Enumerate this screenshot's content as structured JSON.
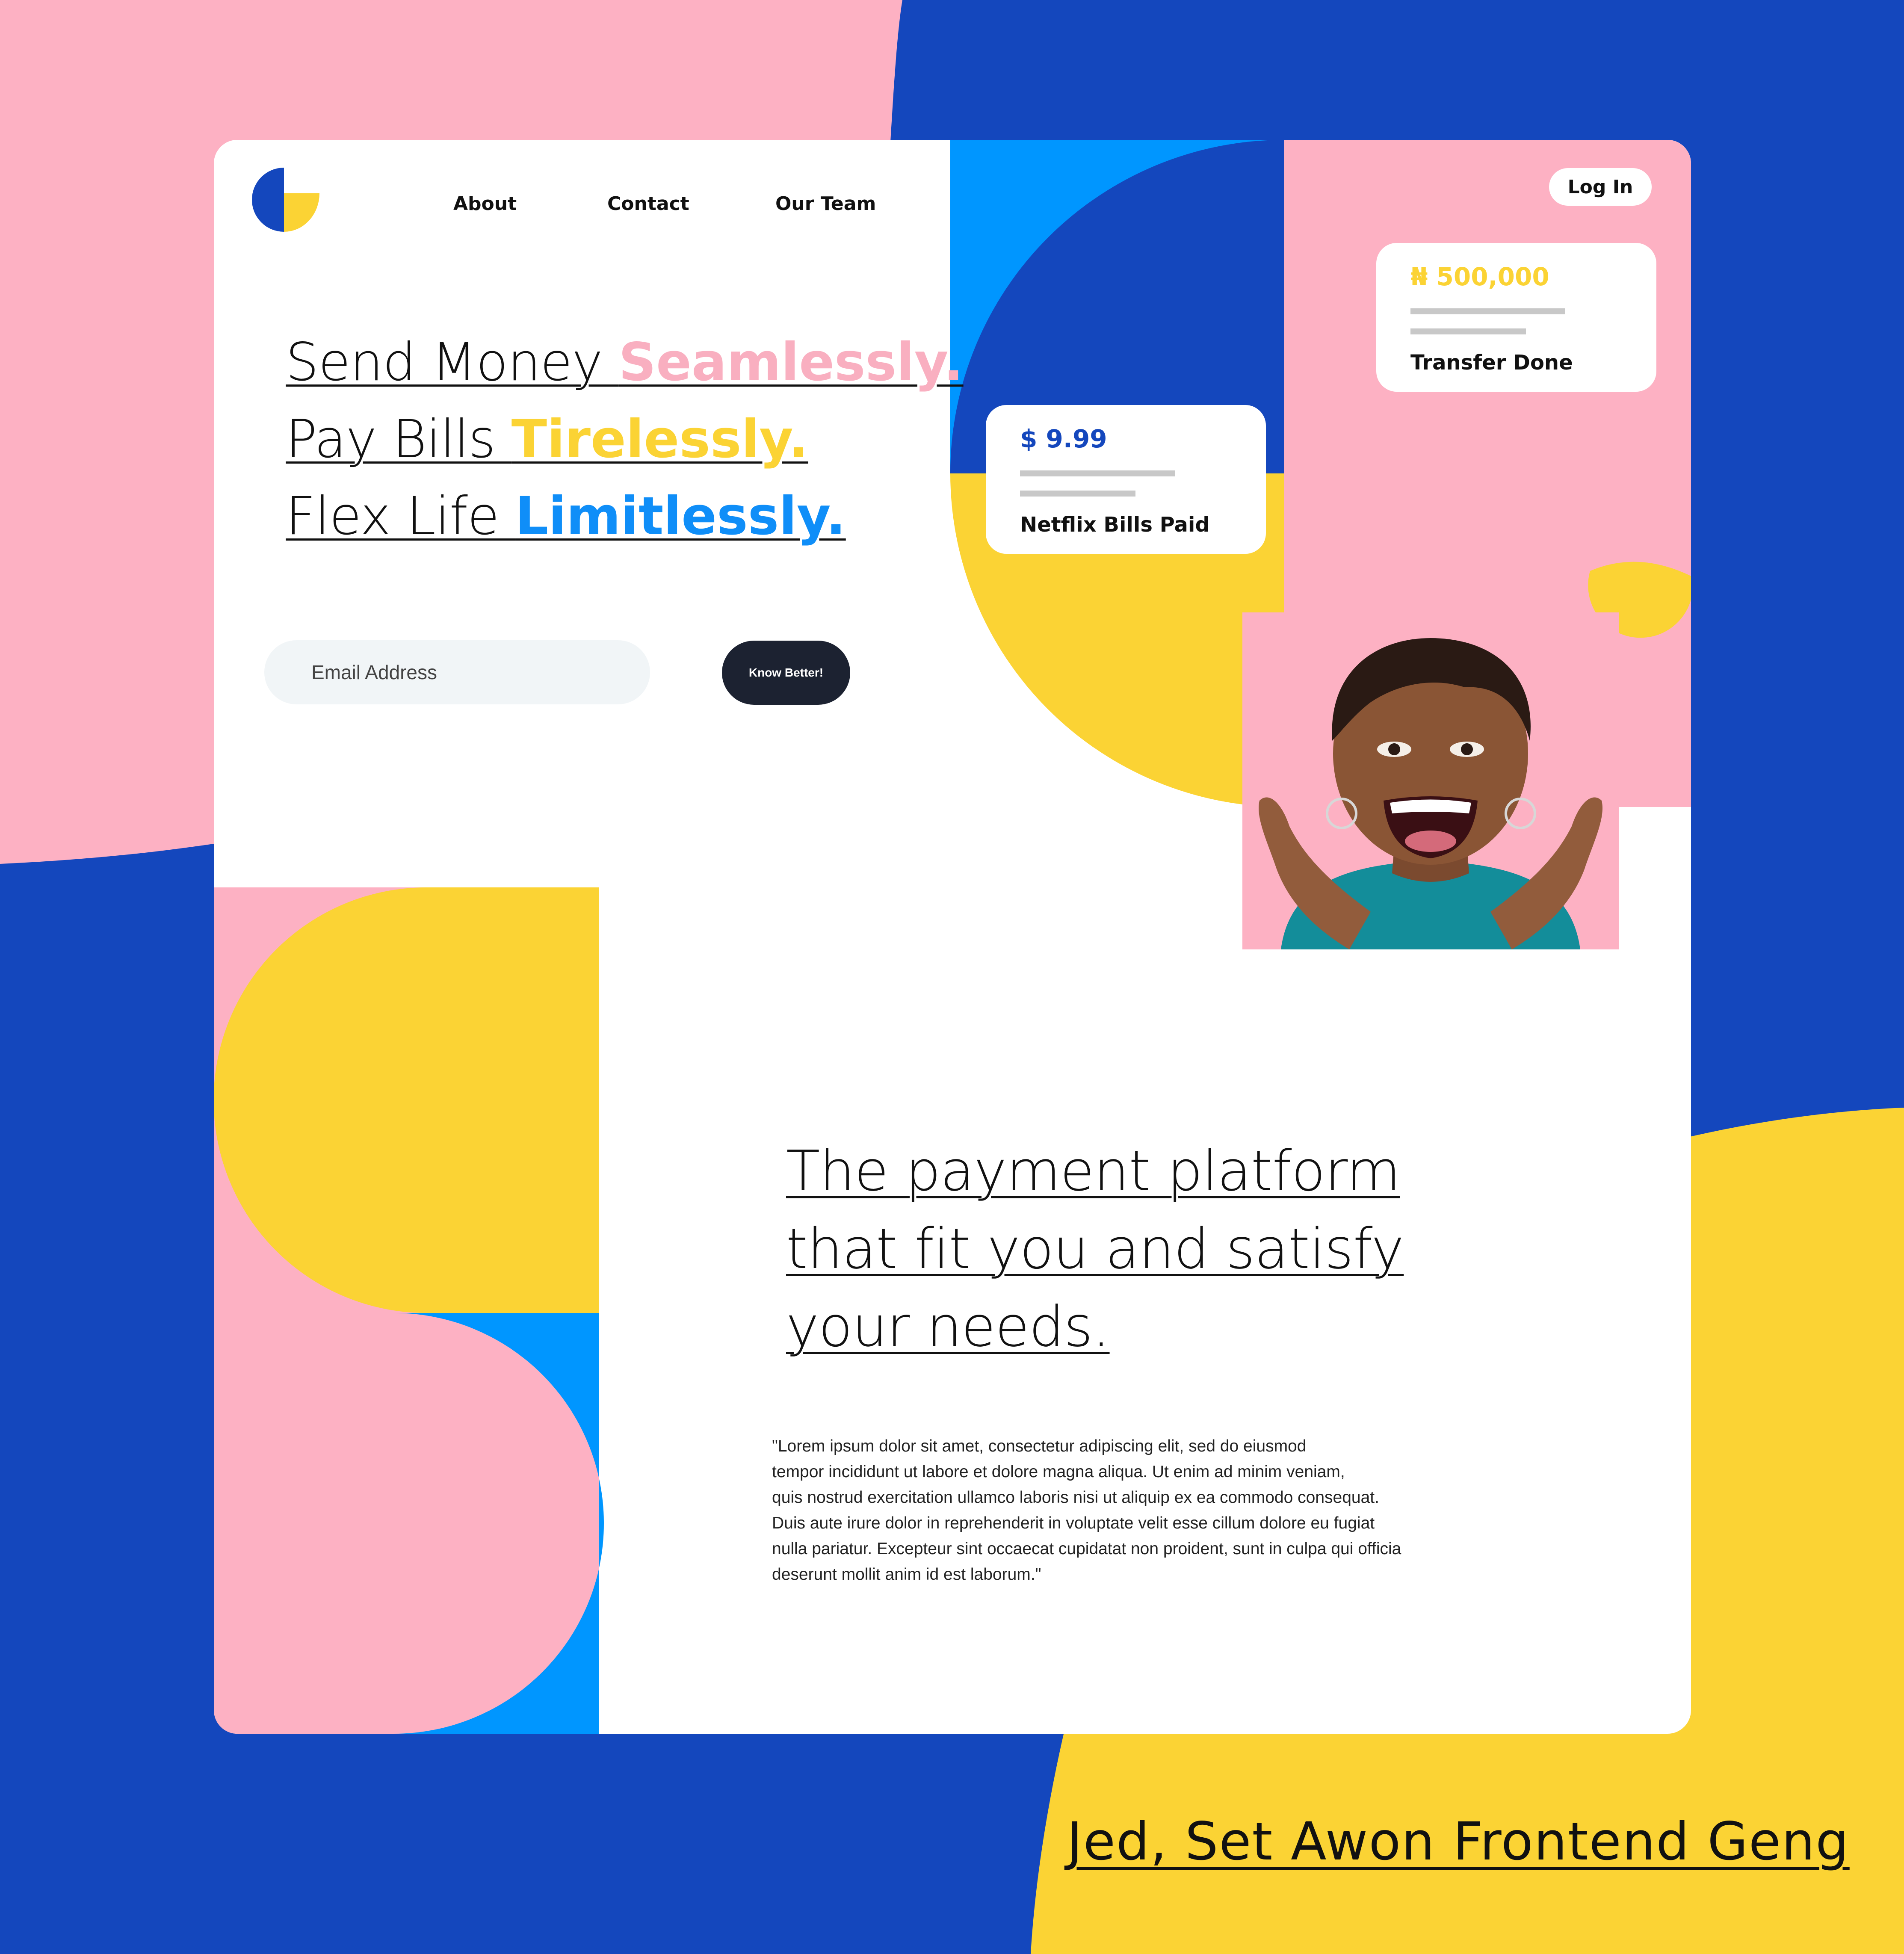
{
  "colors": {
    "royal_blue": "#1447bd",
    "bright_blue": "#0096ff",
    "pink": "#fdb1c3",
    "yellow": "#fbd334",
    "dark": "#1c2231"
  },
  "logo": {
    "icon": "half-circle-logo-icon"
  },
  "nav": {
    "items": [
      "About",
      "Contact",
      "Our Team"
    ],
    "login_label": "Log In"
  },
  "hero": {
    "line1_plain": "Send Money ",
    "line1_accent": "Seamlessly.",
    "line2_plain": "Pay Bills ",
    "line2_accent": "Tirelessly.",
    "line3_plain": "Flex Life ",
    "line3_accent": "Limitlessly."
  },
  "signup": {
    "email_placeholder": "Email Address",
    "cta_label": "Know Better!"
  },
  "netflix_card": {
    "amount": "$ 9.99",
    "label": "Netflix Bills Paid"
  },
  "transfer_card": {
    "amount": "₦ 500,000",
    "label": "Transfer Done"
  },
  "about": {
    "tagline_lines": [
      "The payment platform ",
      "that fit you and satisfy ",
      "your needs."
    ],
    "quote_lines": [
      "\"Lorem ipsum dolor sit amet, consectetur adipiscing elit, sed do eiusmod",
      "tempor incididunt ut labore et dolore magna aliqua. Ut enim ad minim veniam,",
      "quis nostrud exercitation ullamco laboris nisi ut aliquip ex ea commodo consequat.",
      "Duis aute irure dolor in reprehenderit in voluptate velit esse cillum dolore eu fugiat",
      "nulla pariatur. Excepteur sint occaecat cupidatat non proident, sunt in culpa qui officia",
      "deserunt mollit anim id est laborum.\""
    ]
  },
  "credit": "Jed, Set Awon Frontend Geng"
}
